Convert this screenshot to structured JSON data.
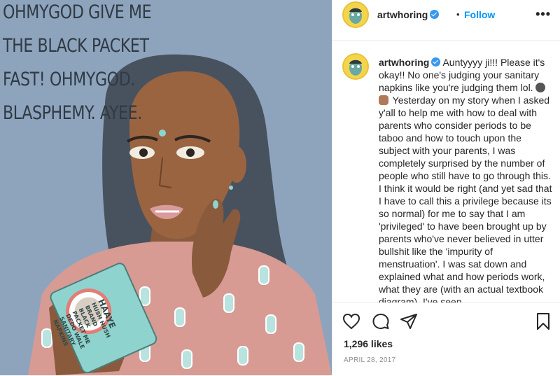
{
  "artwork": {
    "caption_lines": [
      "OHMYGOD GIVE ME",
      "THE BLACK PACKET",
      "FAST! OHMYGOD.",
      "BLASPHEMY. AYEE."
    ],
    "packet_brand": "HAAYE",
    "packet_lines": [
      "HUSH HUSH",
      "BRAND",
      "BLACK",
      "PACKET ME",
      "DEDO WALE",
      "SANITARY",
      "NAPKINS"
    ]
  },
  "header": {
    "username": "artwhoring",
    "separator": "•",
    "follow_label": "Follow",
    "more_label": "•••"
  },
  "comment": {
    "username": "artwhoring",
    "text_first": "Auntyyyy ji!!! Please it's okay!! No one's judging your sanitary napkins like you're judging them lol.",
    "text_second": "Yesterday on my story when I asked y'all to help me with how to deal with parents who consider periods to be taboo and how to touch upon the subject with your parents, I was completely surprised by the number of people who still have to go through this. I think it would be right (and yet sad that I have to call this a privilege because its so normal) for me to say that I am 'privileged' to have been brought up by parents who've never believed in utter bullshit like the 'impurity of menstruation'. I was sat down and explained what and how periods work, what they are (with an actual textbook diagram). I've seen"
  },
  "actions": {
    "likes": "1,296 likes",
    "date": "APRIL 28, 2017"
  },
  "icons": [
    "heart-icon",
    "comment-icon",
    "share-icon",
    "bookmark-icon",
    "more-icon",
    "verified-badge-icon"
  ],
  "colors": {
    "accent": "#0095f6",
    "artwork_bg": "#8ea4bd",
    "avatar_bg": "#f3d54d"
  }
}
